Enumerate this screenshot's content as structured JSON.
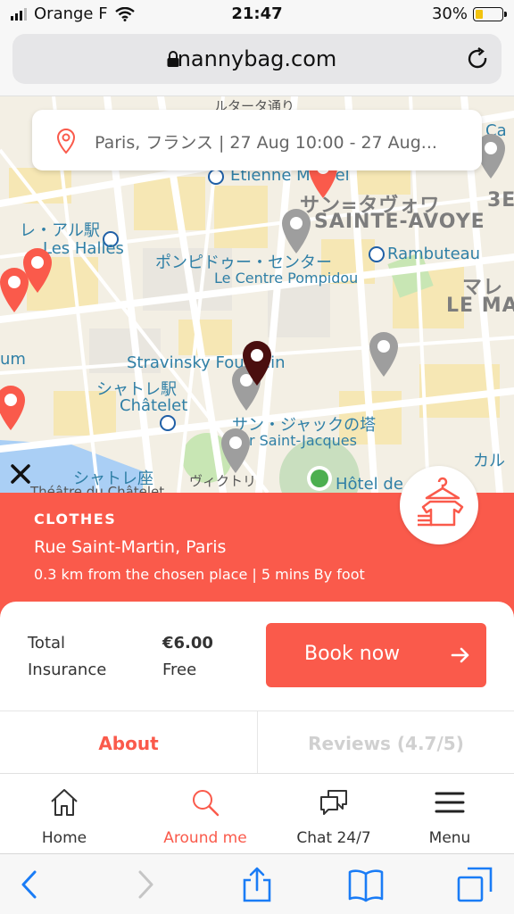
{
  "status_bar": {
    "carrier": "Orange F",
    "time": "21:47",
    "battery_percent": "30%",
    "battery_level": 0.3
  },
  "browser": {
    "url": "nannybag.com"
  },
  "map": {
    "search_text": "Paris, フランス | 27 Aug 10:00 - 27 Aug...",
    "labels": {
      "etienne": "Etienne Marcel",
      "sainte_avoye_jp": "サン=タヴォワ",
      "sainte_avoye": "SAINTE-AVOYE",
      "halles_jp": "レ・アル駅",
      "halles": "Les Halles",
      "pompidou_jp": "ポンピドゥー・センター",
      "pompidou": "Le Centre Pompidou",
      "rambuteau": "Rambuteau",
      "marais_jp": "マレ",
      "marais": "LE MA",
      "stravinsky": "Stravinsky Fountain",
      "chatelet_jp": "シャトレ駅",
      "chatelet": "Châtelet",
      "saint_jacques_jp": "サン・ジャックの塔",
      "saint_jacques": "Tour Saint-Jacques",
      "theatre_jp": "シャトレ座",
      "theatre": "Théâtre du Châtelet",
      "hotel": "Hôtel de",
      "rum": "um",
      "ca": "Ca",
      "karu": "カル",
      "three_e": "3E",
      "top_street": "ルタータ通り",
      "victoria": "ヴィクトリ"
    }
  },
  "listing": {
    "category": "CLOTHES",
    "address": "Rue Saint-Martin, Paris",
    "distance": "0.3 km from the chosen place | 5 mins By foot"
  },
  "booking": {
    "total_label": "Total",
    "total_value": "€6.00",
    "insurance_label": "Insurance",
    "insurance_value": "Free",
    "book_label": "Book now"
  },
  "tabs": {
    "about": "About",
    "reviews": "Reviews (4.7/5)"
  },
  "bottom_nav": {
    "home": "Home",
    "around": "Around me",
    "chat": "Chat 24/7",
    "menu": "Menu"
  },
  "colors": {
    "accent": "#fa5a4b",
    "map_bg": "#f3efe4",
    "road": "#ffffff",
    "block": "#f6e7b4",
    "park": "#c8e6b4",
    "water": "#aacff5",
    "marker_grey": "#9e9e9e",
    "marker_selected": "#4a0f0f",
    "location_dot": "#4caf50"
  },
  "icons": {
    "lock": "lock-icon",
    "reload": "reload-icon",
    "location": "location-pin-icon",
    "close": "close-icon",
    "clothes": "clothes-hanger-icon",
    "arrow": "arrow-right-icon",
    "home": "home-icon",
    "search": "search-icon",
    "chat": "chat-icon",
    "menu": "hamburger-icon",
    "back": "back-icon",
    "forward": "forward-icon",
    "share": "share-icon",
    "bookmarks": "bookmarks-icon",
    "tabs": "tabs-icon"
  }
}
